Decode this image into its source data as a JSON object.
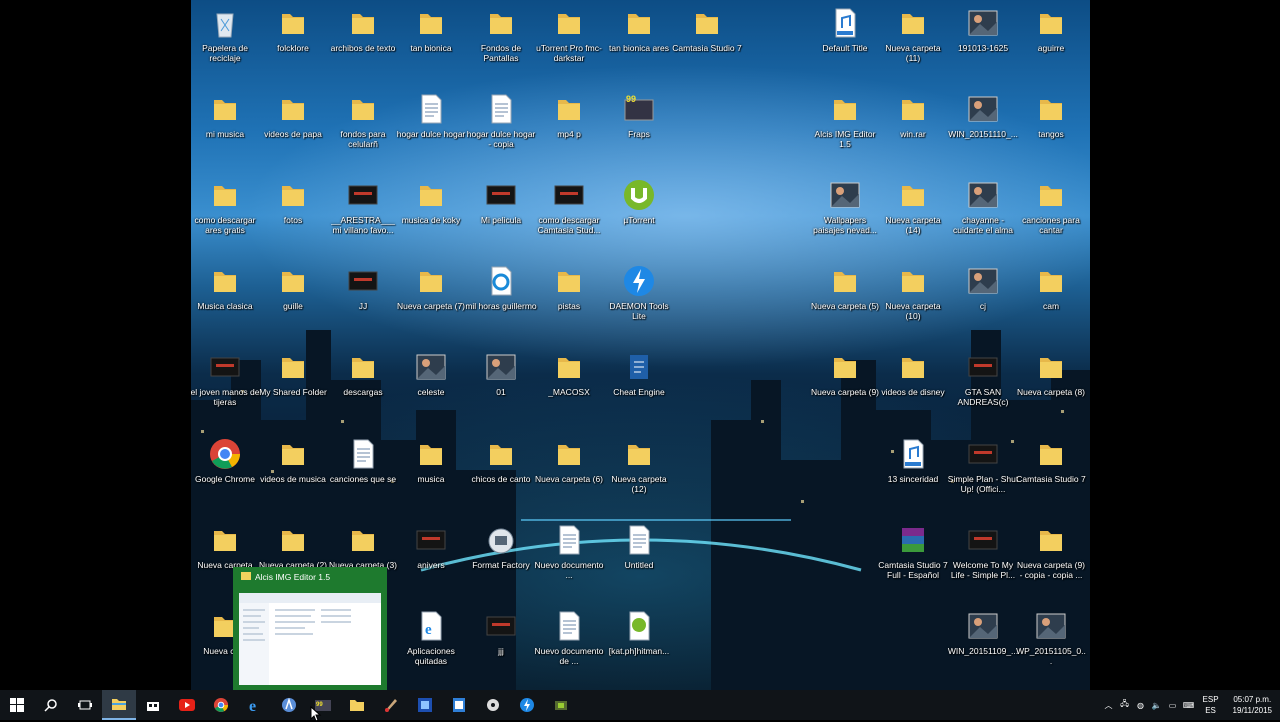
{
  "desktop": {
    "icons": [
      {
        "label": "Papelera de reciclaje",
        "icon": "recycle-bin-icon"
      },
      {
        "label": "folcklore",
        "icon": "folder-icon"
      },
      {
        "label": "archibos de texto",
        "icon": "folder-icon"
      },
      {
        "label": "tan bionica",
        "icon": "folder-icon"
      },
      {
        "label": "Fondos de Pantallas",
        "icon": "folder-icon"
      },
      {
        "label": "uTorrent Pro fmc-darkstar",
        "icon": "folder-icon"
      },
      {
        "label": "tan bionica ares",
        "icon": "folder-icon"
      },
      {
        "label": "Camtasia Studio 7",
        "icon": "folder-icon"
      },
      {
        "label": "Default Title",
        "icon": "mp3-file-icon"
      },
      {
        "label": "Nueva carpeta (11)",
        "icon": "folder-icon"
      },
      {
        "label": "191013-1625",
        "icon": "image-file-icon"
      },
      {
        "label": "aguirre",
        "icon": "folder-icon"
      },
      {
        "label": "mi musica",
        "icon": "folder-icon"
      },
      {
        "label": "videos de papa",
        "icon": "folder-icon"
      },
      {
        "label": "fondos para celularñ",
        "icon": "folder-icon"
      },
      {
        "label": "hogar dulce hogar",
        "icon": "document-icon"
      },
      {
        "label": "hogar dulce hogar - copia",
        "icon": "document-icon"
      },
      {
        "label": "mp4 p",
        "icon": "folder-icon"
      },
      {
        "label": "Fraps",
        "icon": "fraps-icon"
      },
      {
        "label": "Alcis IMG Editor 1.5",
        "icon": "folder-icon"
      },
      {
        "label": "win.rar",
        "icon": "folder-icon"
      },
      {
        "label": "WIN_20151110_...",
        "icon": "image-file-icon"
      },
      {
        "label": "tangos",
        "icon": "folder-icon"
      },
      {
        "label": "como descargar ares gratis",
        "icon": "folder-icon"
      },
      {
        "label": "fotos",
        "icon": "folder-icon"
      },
      {
        "label": "__ARESTRA___ mi villano favo...",
        "icon": "video-file-icon"
      },
      {
        "label": "musica de koky",
        "icon": "folder-icon"
      },
      {
        "label": "Mi pelicula",
        "icon": "video-file-icon"
      },
      {
        "label": "como descargar Camtasia Stud...",
        "icon": "video-file-icon"
      },
      {
        "label": "µTorrent",
        "icon": "utorrent-icon"
      },
      {
        "label": "Wallpapers paisajes nevad...",
        "icon": "image-file-icon"
      },
      {
        "label": "Nueva carpeta (14)",
        "icon": "folder-icon"
      },
      {
        "label": "chayanne - cuidarte el alma",
        "icon": "image-file-icon"
      },
      {
        "label": "canciones para cantar",
        "icon": "folder-icon"
      },
      {
        "label": "Musica clasica",
        "icon": "folder-icon"
      },
      {
        "label": "guille",
        "icon": "folder-icon"
      },
      {
        "label": "JJ",
        "icon": "video-file-icon"
      },
      {
        "label": "Nueva carpeta (7)",
        "icon": "folder-icon"
      },
      {
        "label": "mil horas guillermo",
        "icon": "media-file-icon"
      },
      {
        "label": "pistas",
        "icon": "folder-icon"
      },
      {
        "label": "DAEMON Tools Lite",
        "icon": "daemon-tools-icon"
      },
      {
        "label": "Nueva carpeta (5)",
        "icon": "folder-icon"
      },
      {
        "label": "Nueva carpeta (10)",
        "icon": "folder-icon"
      },
      {
        "label": "cj",
        "icon": "image-file-icon"
      },
      {
        "label": "cam",
        "icon": "folder-icon"
      },
      {
        "label": "el joven manos de tijeras",
        "icon": "video-file-icon"
      },
      {
        "label": "My Shared Folder",
        "icon": "folder-icon"
      },
      {
        "label": "descargas",
        "icon": "folder-icon"
      },
      {
        "label": "celeste",
        "icon": "image-file-icon"
      },
      {
        "label": "01",
        "icon": "image-file-icon"
      },
      {
        "label": "_MACOSX",
        "icon": "folder-icon"
      },
      {
        "label": "Cheat Engine",
        "icon": "cheat-engine-icon"
      },
      {
        "label": "Nueva carpeta (9)",
        "icon": "folder-icon"
      },
      {
        "label": "videos de disney",
        "icon": "folder-icon"
      },
      {
        "label": "GTA SAN ANDREAS(c)",
        "icon": "video-file-icon"
      },
      {
        "label": "Nueva carpeta (8)",
        "icon": "folder-icon"
      },
      {
        "label": "Google Chrome",
        "icon": "chrome-icon"
      },
      {
        "label": "videos de musica",
        "icon": "folder-icon"
      },
      {
        "label": "canciones que se",
        "icon": "document-icon"
      },
      {
        "label": "musica",
        "icon": "folder-icon"
      },
      {
        "label": "chicos de canto",
        "icon": "folder-icon"
      },
      {
        "label": "Nueva carpeta (6)",
        "icon": "folder-icon"
      },
      {
        "label": "Nueva carpeta (12)",
        "icon": "folder-icon"
      },
      {
        "label": "13 sinceridad",
        "icon": "mp3-file-icon"
      },
      {
        "label": "Simple Plan - Shut Up! (Offici...",
        "icon": "video-file-icon"
      },
      {
        "label": "Camtasia Studio 7",
        "icon": "folder-icon"
      },
      {
        "label": "Nueva carpeta",
        "icon": "folder-icon"
      },
      {
        "label": "Nueva carpeta (2)",
        "icon": "folder-icon"
      },
      {
        "label": "Nueva carpeta (3)",
        "icon": "folder-icon"
      },
      {
        "label": "anivers",
        "icon": "video-file-icon"
      },
      {
        "label": "Format Factory",
        "icon": "format-factory-icon"
      },
      {
        "label": "Nuevo documento ...",
        "icon": "document-icon"
      },
      {
        "label": "Untitled",
        "icon": "document-icon"
      },
      {
        "label": "Camtasia Studio 7 Full - Español",
        "icon": "winrar-icon"
      },
      {
        "label": "Welcome To My Life - Simple Pl...",
        "icon": "video-file-icon"
      },
      {
        "label": "Nueva carpeta (9) - copia - copia ...",
        "icon": "folder-icon"
      },
      {
        "label": "Nueva carp",
        "icon": "folder-icon"
      },
      {
        "label": "Aplicaciones quitadas",
        "icon": "ie-document-icon"
      },
      {
        "label": "jjj",
        "icon": "video-file-icon"
      },
      {
        "label": "Nuevo documento de ...",
        "icon": "document-icon"
      },
      {
        "label": "[kat.ph]hitman...",
        "icon": "utorrent-file-icon"
      },
      {
        "label": "WIN_20151109_...",
        "icon": "image-file-icon"
      },
      {
        "label": "WP_20151105_0...",
        "icon": "image-file-icon"
      }
    ]
  },
  "preview": {
    "title": "Alcis IMG Editor 1.5"
  },
  "taskbar": {
    "items": [
      {
        "icon": "windows-start-icon"
      },
      {
        "icon": "search-icon"
      },
      {
        "icon": "task-view-icon"
      },
      {
        "icon": "file-explorer-icon",
        "active": true
      },
      {
        "icon": "store-icon"
      },
      {
        "icon": "youtube-icon"
      },
      {
        "icon": "chrome-icon"
      },
      {
        "icon": "edge-icon"
      },
      {
        "icon": "ares-icon"
      },
      {
        "icon": "fraps-icon"
      },
      {
        "icon": "folder-icon"
      },
      {
        "icon": "paint-icon"
      },
      {
        "icon": "image-editor-icon"
      },
      {
        "icon": "notepad-icon"
      },
      {
        "icon": "settings-icon"
      },
      {
        "icon": "daemon-tools-icon"
      },
      {
        "icon": "camtasia-icon"
      }
    ],
    "language": {
      "line1": "ESP",
      "line2": "ES"
    },
    "clock": {
      "time": "05:07 p.m.",
      "date": "19/11/2015"
    }
  },
  "colors": {
    "folder": "#f3cf5f",
    "taskbar": "#101418",
    "preview": "#1e7a2e"
  }
}
